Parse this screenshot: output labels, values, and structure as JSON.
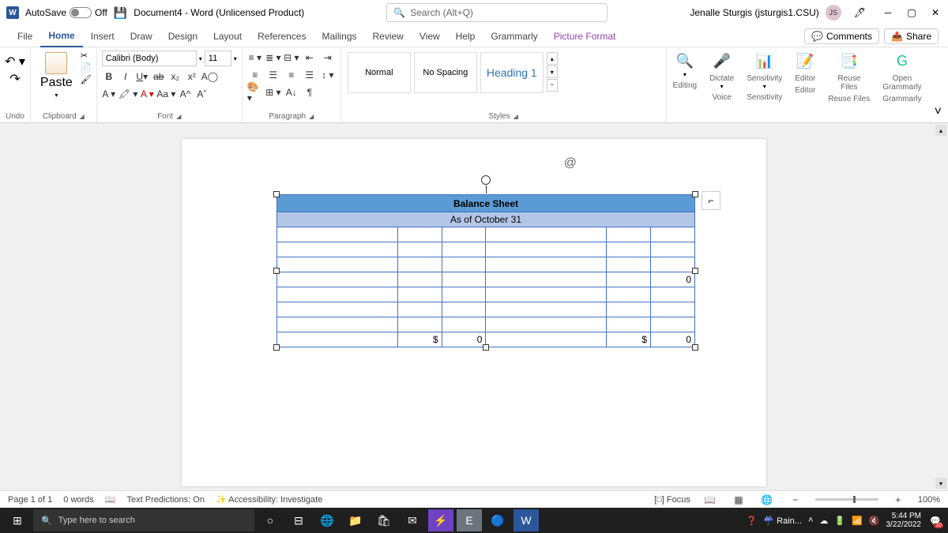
{
  "title_bar": {
    "autosave_label": "AutoSave",
    "autosave_state": "Off",
    "doc_title": "Document4 - Word (Unlicensed Product)",
    "search_placeholder": "Search (Alt+Q)",
    "user_name": "Jenalle Sturgis (jsturgis1.CSU)",
    "user_initials": "JS"
  },
  "tabs": {
    "file": "File",
    "home": "Home",
    "insert": "Insert",
    "draw": "Draw",
    "design": "Design",
    "layout": "Layout",
    "references": "References",
    "mailings": "Mailings",
    "review": "Review",
    "view": "View",
    "help": "Help",
    "grammarly": "Grammarly",
    "picture_format": "Picture Format",
    "comments": "Comments",
    "share": "Share"
  },
  "ribbon": {
    "undo": "Undo",
    "clipboard": "Clipboard",
    "paste": "Paste",
    "font": "Font",
    "font_name": "Calibri (Body)",
    "font_size": "11",
    "paragraph": "Paragraph",
    "styles": "Styles",
    "style_normal": "Normal",
    "style_nospacing": "No Spacing",
    "style_heading1": "Heading 1",
    "editing": "Editing",
    "dictate": "Dictate",
    "voice": "Voice",
    "sensitivity": "Sensitivity",
    "editor": "Editor",
    "reuse_files": "Reuse Files",
    "open_grammarly": "Open Grammarly",
    "grammarly": "Grammarly",
    "reuse": "Reuse",
    "files": "Files",
    "open": "Open"
  },
  "document": {
    "table_title": "Balance Sheet",
    "table_subtitle": "As of October 31",
    "zero": "0",
    "dollar": "$"
  },
  "status": {
    "page": "Page 1 of 1",
    "words": "0 words",
    "predictions": "Text Predictions: On",
    "accessibility": "Accessibility: Investigate",
    "focus": "Focus",
    "zoom": "100%"
  },
  "taskbar": {
    "search": "Type here to search",
    "weather": "Rain...",
    "time": "5:44 PM",
    "date": "3/22/2022",
    "notif_count": "10"
  }
}
